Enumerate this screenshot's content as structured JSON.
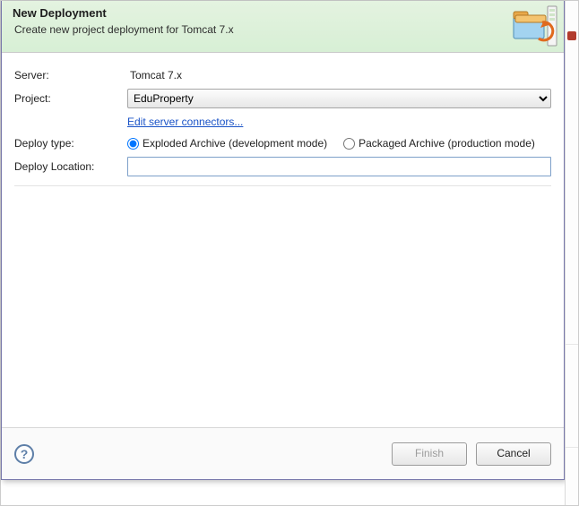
{
  "header": {
    "title": "New Deployment",
    "subtitle": "Create new project deployment for Tomcat  7.x"
  },
  "form": {
    "server_label": "Server:",
    "server_value": "Tomcat  7.x",
    "project_label": "Project:",
    "project_value": "EduProperty",
    "edit_connectors_link": "Edit server connectors...",
    "deploy_type_label": "Deploy type:",
    "radio_exploded": "Exploded Archive (development mode)",
    "radio_packaged": "Packaged Archive (production mode)",
    "deploy_location_label": "Deploy Location:",
    "deploy_location_value": ""
  },
  "footer": {
    "help_symbol": "?",
    "finish": "Finish",
    "cancel": "Cancel"
  }
}
